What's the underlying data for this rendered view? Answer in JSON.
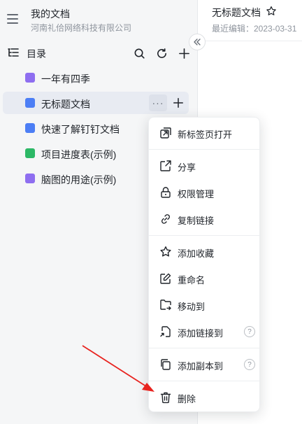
{
  "workspace": {
    "name": "我的文档",
    "org": "河南礼佮网络科技有限公司"
  },
  "toc": {
    "title": "目录"
  },
  "tree": [
    {
      "label": "一年有四季",
      "icon": "mindmap-icon",
      "color": "#8e6ef0"
    },
    {
      "label": "无标题文档",
      "icon": "doc-icon",
      "color": "#4c7ef5"
    },
    {
      "label": "快速了解钉钉文档",
      "icon": "doc-icon",
      "color": "#4c7ef5"
    },
    {
      "label": "项目进度表(示例)",
      "icon": "sheet-icon",
      "color": "#2cb866"
    },
    {
      "label": "脑图的用途(示例)",
      "icon": "mindmap-icon",
      "color": "#8e6ef0"
    }
  ],
  "tree_more": "···",
  "doc": {
    "title": "无标题文档",
    "edited": "最近编辑：2023-03-31"
  },
  "menu": {
    "open_new_tab": "新标签页打开",
    "share": "分享",
    "permissions": "权限管理",
    "copy_link": "复制链接",
    "add_favorite": "添加收藏",
    "rename": "重命名",
    "move_to": "移动到",
    "add_link_to": "添加链接到",
    "add_copy_to": "添加副本到",
    "delete": "删除",
    "help": "?"
  },
  "colors": {
    "annotation_arrow": "#e8231f",
    "active_row": "#e8ebf2"
  }
}
